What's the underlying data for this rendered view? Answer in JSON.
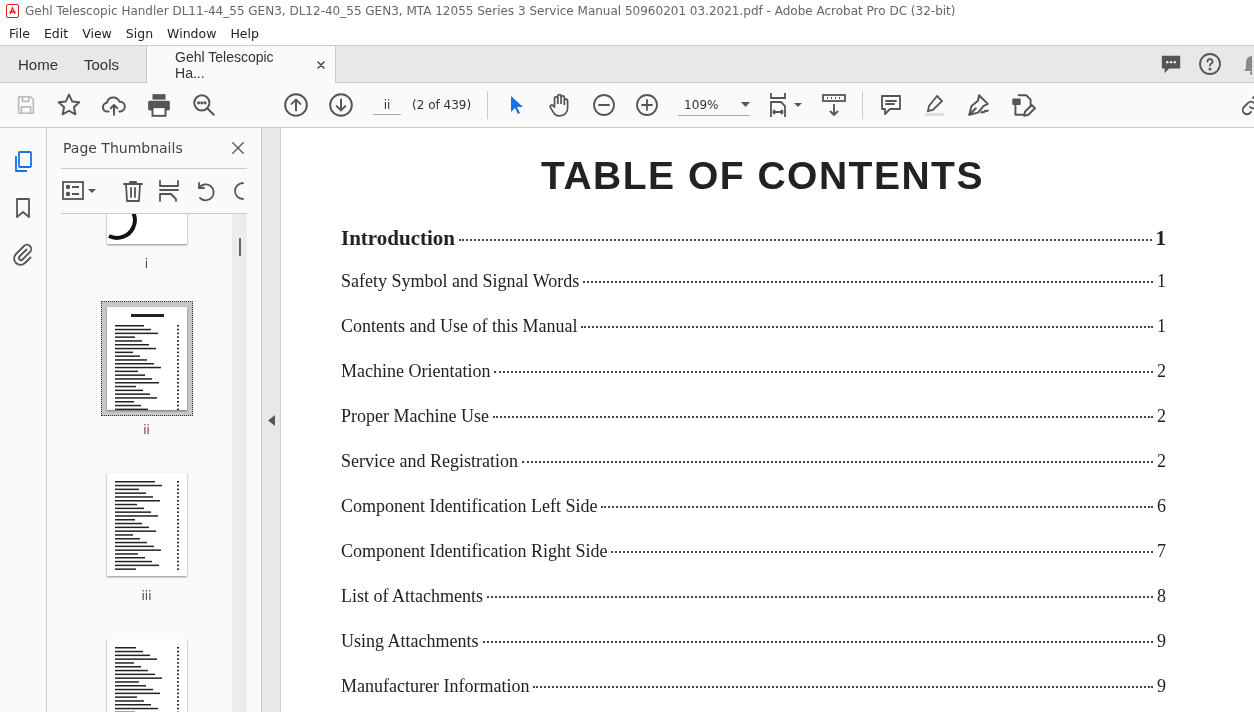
{
  "window": {
    "title": "Gehl Telescopic Handler DL11-44_55 GEN3, DL12-40_55 GEN3, MTA 12055 Series 3 Service Manual 50960201 03.2021.pdf - Adobe Acrobat Pro DC (32-bit)"
  },
  "menu": [
    "File",
    "Edit",
    "View",
    "Sign",
    "Window",
    "Help"
  ],
  "tabs": [
    {
      "label": "Home",
      "selected": false
    },
    {
      "label": "Tools",
      "selected": false
    },
    {
      "label": "Gehl Telescopic Ha...",
      "selected": true
    }
  ],
  "toolbar": {
    "save_disabled": true,
    "page_field": "ii",
    "page_count": "(2 of 439)",
    "zoom": "109%",
    "select_tool_selected": true,
    "hand_tool_selected": false
  },
  "sidebar": {
    "rail": [
      {
        "kind": "pages",
        "selected": true
      },
      {
        "kind": "bookmarks",
        "selected": false
      },
      {
        "kind": "attachments",
        "selected": false
      }
    ],
    "panel_title": "Page Thumbnails",
    "thumbnails": [
      {
        "kind": "cover",
        "label": "i",
        "selected": false
      },
      {
        "kind": "toc",
        "label": "ii",
        "selected": true
      },
      {
        "kind": "toc",
        "label": "iii",
        "selected": false
      },
      {
        "kind": "toc",
        "selected": false
      }
    ]
  },
  "document": {
    "heading": "TABLE OF CONTENTS",
    "entries": [
      {
        "kind": "section",
        "title": "Introduction",
        "page": "1"
      },
      {
        "kind": "entry",
        "title": "Safety Symbol and Signal Words",
        "page": "1"
      },
      {
        "kind": "entry",
        "title": "Contents and Use of this Manual",
        "page": "1"
      },
      {
        "kind": "entry",
        "title": "Machine Orientation",
        "page": "2"
      },
      {
        "kind": "entry",
        "title": "Proper Machine Use",
        "page": "2"
      },
      {
        "kind": "entry",
        "title": "Service and Registration",
        "page": "2"
      },
      {
        "kind": "entry",
        "title": "Component Identification Left Side",
        "page": "6"
      },
      {
        "kind": "entry",
        "title": "Component Identification Right Side",
        "page": "7"
      },
      {
        "kind": "entry",
        "title": "List of Attachments",
        "page": "8"
      },
      {
        "kind": "entry",
        "title": "Using Attachments",
        "page": "9"
      },
      {
        "kind": "entry",
        "title": "Manufacturer Information",
        "page": "9"
      }
    ]
  }
}
